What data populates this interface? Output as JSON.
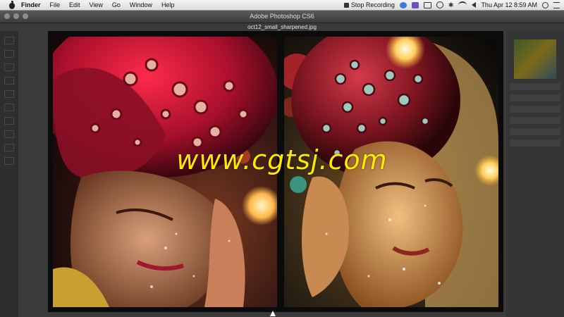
{
  "menubar": {
    "app_name": "Finder",
    "items": [
      "File",
      "Edit",
      "View",
      "Go",
      "Window",
      "Help"
    ],
    "recording_label": "Stop Recording",
    "datetime": "Thu Apr 12  8:59 AM"
  },
  "window": {
    "app_title": "Adobe Photoshop CS6",
    "document_title": "oct12_small_sharpened.jpg"
  },
  "watermark": "www.cgtsj.com",
  "colors": {
    "watermark": "#ffea00",
    "overlay_frame": "#0b0b0b",
    "photo_left_dominant": "#c2183a",
    "photo_right_dominant": "#e08a1a"
  }
}
